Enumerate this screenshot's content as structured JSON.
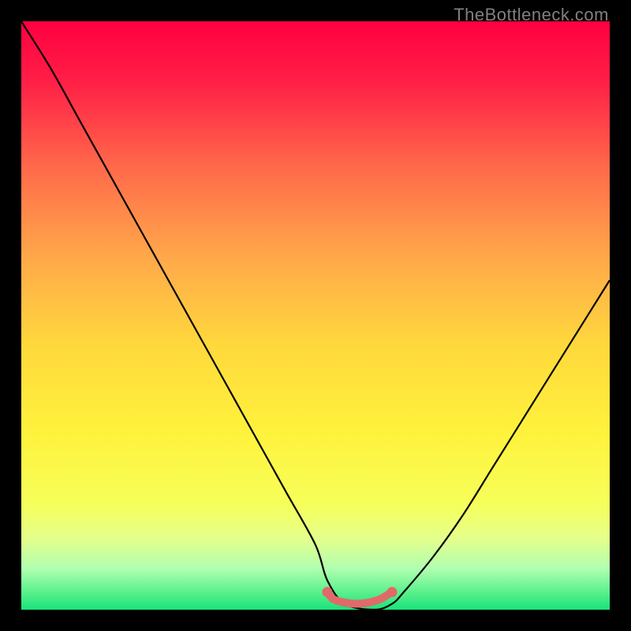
{
  "watermark": "TheBottleneck.com",
  "chart_data": {
    "type": "line",
    "title": "",
    "xlabel": "",
    "ylabel": "",
    "x_range": [
      0,
      100
    ],
    "y_range": [
      0,
      100
    ],
    "series": [
      {
        "name": "bottleneck-curve",
        "x": [
          0,
          5,
          10,
          15,
          20,
          25,
          30,
          35,
          40,
          45,
          50,
          52,
          55,
          60,
          63,
          65,
          70,
          75,
          80,
          85,
          90,
          95,
          100
        ],
        "y": [
          100,
          92,
          83,
          74,
          65,
          56,
          47,
          38,
          29,
          20,
          11,
          5,
          1,
          0,
          1,
          3,
          9,
          16,
          24,
          32,
          40,
          48,
          56
        ]
      },
      {
        "name": "optimal-zone-marker",
        "x": [
          52,
          53,
          55,
          57,
          59,
          61,
          63
        ],
        "y": [
          3.0,
          1.8,
          1.2,
          1.0,
          1.2,
          1.8,
          3.0
        ]
      }
    ],
    "gradient_stops": [
      {
        "pos": 0.0,
        "color": "#ff0040"
      },
      {
        "pos": 0.1,
        "color": "#ff1e46"
      },
      {
        "pos": 0.25,
        "color": "#ff6a4a"
      },
      {
        "pos": 0.4,
        "color": "#ffa84a"
      },
      {
        "pos": 0.55,
        "color": "#ffd83c"
      },
      {
        "pos": 0.7,
        "color": "#fff23c"
      },
      {
        "pos": 0.82,
        "color": "#f6ff5a"
      },
      {
        "pos": 0.88,
        "color": "#e4ff8c"
      },
      {
        "pos": 0.93,
        "color": "#b0ffb0"
      },
      {
        "pos": 0.97,
        "color": "#5cf08c"
      },
      {
        "pos": 1.0,
        "color": "#18e37a"
      }
    ],
    "marker_color": "#e06a6a",
    "curve_color": "#000000"
  }
}
